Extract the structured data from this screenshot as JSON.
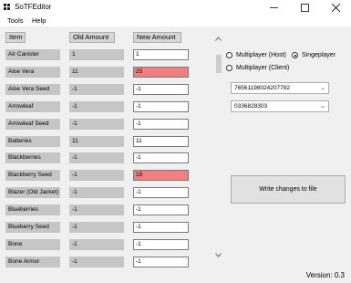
{
  "window": {
    "title": "SoTFEditor",
    "icon": "app-icon"
  },
  "menu": [
    {
      "label": "Tools"
    },
    {
      "label": "Help"
    }
  ],
  "columns": {
    "item": "Item",
    "old_amount": "Old Amount",
    "new_amount": "New Amount"
  },
  "rows": [
    {
      "name": "Air Canister",
      "old": "1",
      "new": "1",
      "changed": false
    },
    {
      "name": "Aloe Vera",
      "old": "11",
      "new": "25",
      "changed": true
    },
    {
      "name": "Aloe Vera Seed",
      "old": "-1",
      "new": "-1",
      "changed": false
    },
    {
      "name": "Arrowleaf",
      "old": "-1",
      "new": "-1",
      "changed": false
    },
    {
      "name": "Arrowleaf Seed",
      "old": "-1",
      "new": "-1",
      "changed": false
    },
    {
      "name": "Batteries",
      "old": "11",
      "new": "11",
      "changed": false
    },
    {
      "name": "Blackberries",
      "old": "-1",
      "new": "-1",
      "changed": false
    },
    {
      "name": "Blackberry Seed",
      "old": "-1",
      "new": "15",
      "changed": true
    },
    {
      "name": "Blazer (Old Jacket)",
      "old": "-1",
      "new": "-1",
      "changed": false
    },
    {
      "name": "Blueberries",
      "old": "-1",
      "new": "-1",
      "changed": false
    },
    {
      "name": "Blueberry Seed",
      "old": "-1",
      "new": "-1",
      "changed": false
    },
    {
      "name": "Bone",
      "old": "-1",
      "new": "-1",
      "changed": false
    },
    {
      "name": "Bone Armor",
      "old": "-1",
      "new": "-1",
      "changed": false
    }
  ],
  "mode": {
    "multiplayer_host": "Multiplayer (Host)",
    "singleplayer": "Singeplayer",
    "multiplayer_client": "Multiplayer (Client)",
    "selected": "singleplayer"
  },
  "steam_id": {
    "value": "76561198024207782"
  },
  "save_id": {
    "value": "0336828303"
  },
  "write_button": {
    "label": "Write changes to file"
  },
  "version": {
    "text": "Version: 0.3"
  },
  "colors": {
    "changed": "#f08080"
  }
}
